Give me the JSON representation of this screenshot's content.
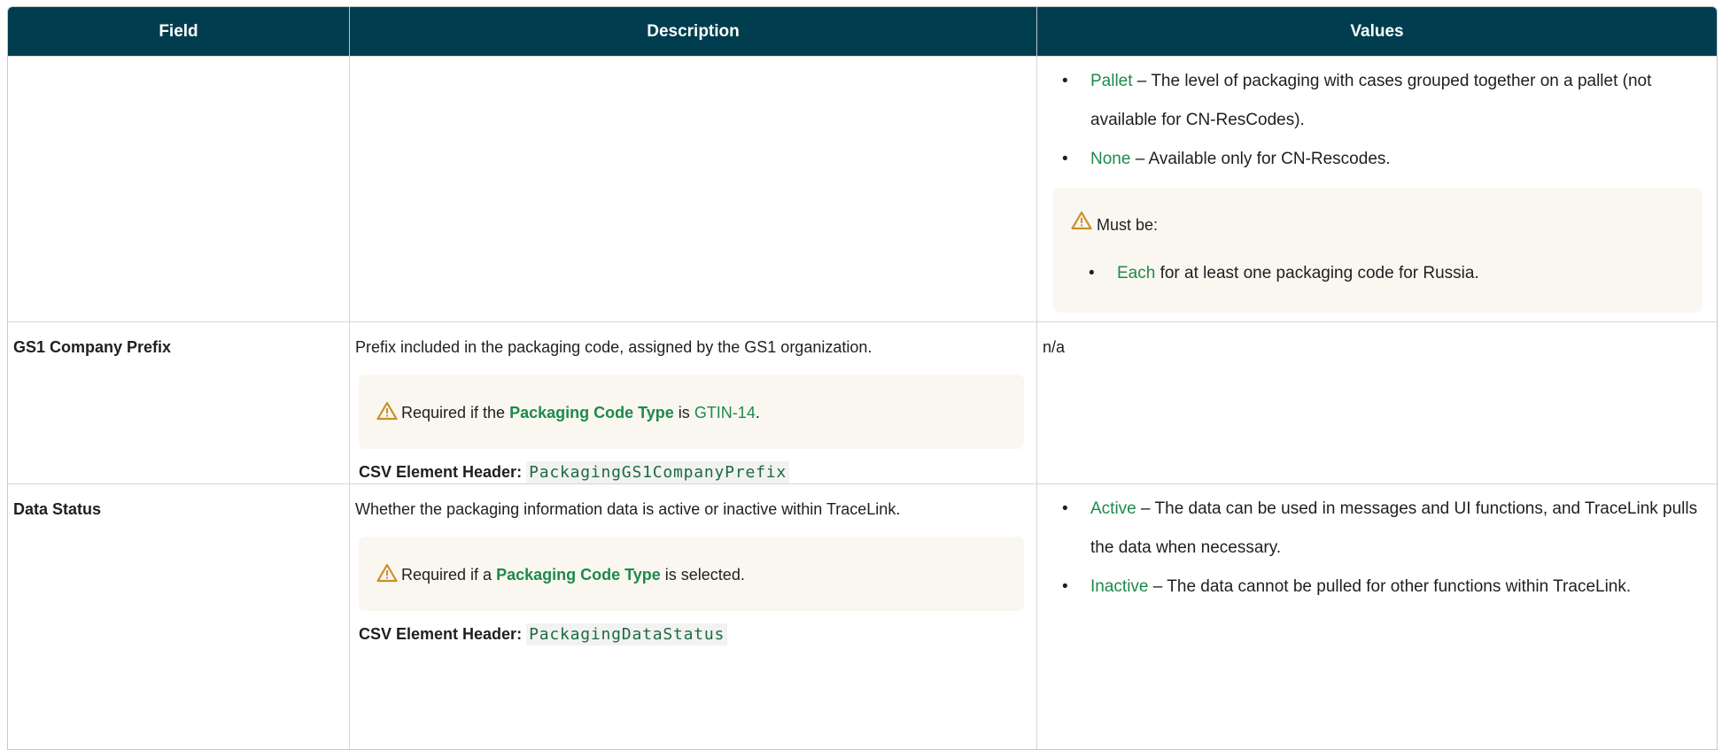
{
  "headers": {
    "field": "Field",
    "description": "Description",
    "values": "Values"
  },
  "row1": {
    "values": [
      {
        "term": "Pallet",
        "text": " – The level of packaging with cases grouped together on a pallet (not available for CN-ResCodes)."
      },
      {
        "term": "None",
        "text": " – Available only for CN-Rescodes."
      }
    ],
    "note": {
      "title": "Must be:",
      "items": [
        {
          "term": "Each",
          "text": " for at least one packaging code for Russia."
        }
      ]
    }
  },
  "row2": {
    "field": "GS1 Company Prefix",
    "description": "Prefix included in the packaging code, assigned by the GS1 organization.",
    "note": {
      "pre": "Required if the ",
      "bold": "Packaging Code Type",
      "mid": " is ",
      "link": "GTIN-14",
      "post": "."
    },
    "csv_label": "CSV Element Header:",
    "csv_code": "PackagingGS1CompanyPrefix",
    "values_text": "n/a"
  },
  "row3": {
    "field": "Data Status",
    "description": "Whether the packaging information data is active or inactive within TraceLink.",
    "note": {
      "pre": "Required if a ",
      "bold": "Packaging Code Type",
      "post": " is selected."
    },
    "csv_label": "CSV Element Header:",
    "csv_code": "PackagingDataStatus",
    "values": [
      {
        "term": "Active",
        "text": " – The data can be used in messages and UI functions, and TraceLink pulls the data when necessary."
      },
      {
        "term": "Inactive",
        "text": " – The data cannot be pulled for other functions within TraceLink."
      }
    ]
  },
  "colors": {
    "header_bg": "#003d4f",
    "accent_green": "#1d8a4a",
    "note_bg": "#faf7f1",
    "warning": "#c9902a"
  },
  "icons": {
    "warning": "warning-triangle-icon"
  }
}
